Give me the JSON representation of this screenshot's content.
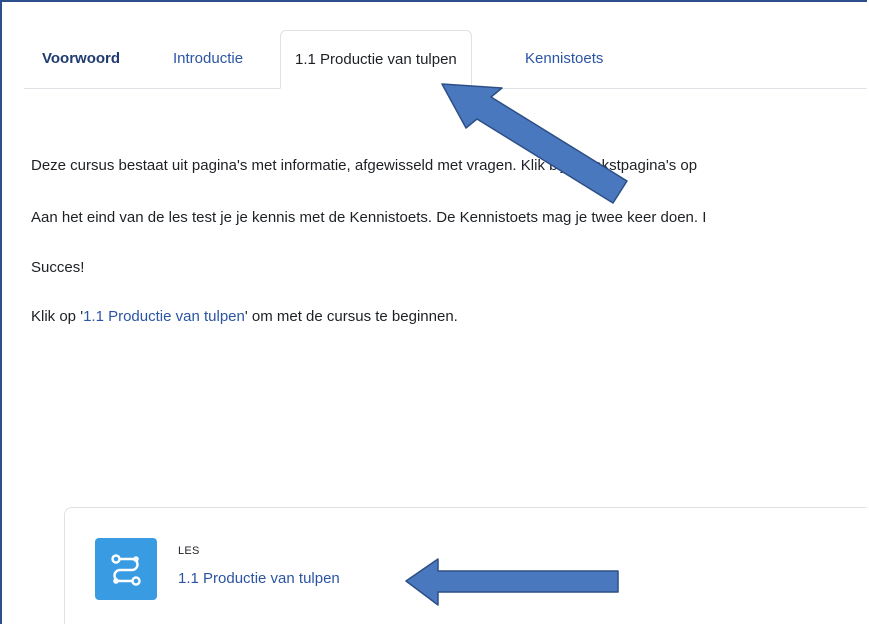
{
  "tabs": [
    {
      "label": "Voorwoord"
    },
    {
      "label": "Introductie"
    },
    {
      "label": "1.1 Productie van tulpen"
    },
    {
      "label": "Kennistoets"
    }
  ],
  "content": {
    "paragraph1": "Deze cursus bestaat uit pagina's met informatie, afgewisseld met vragen. Klik bij de tekstpagina's op",
    "paragraph2": "Aan het eind van de les test je je kennis met de Kennistoets. De Kennistoets mag je twee keer doen. I",
    "paragraph3": "Succes!",
    "paragraph4_prefix": "Klik op '",
    "paragraph4_link": "1.1 Productie van tulpen",
    "paragraph4_suffix": "' om met de cursus te beginnen."
  },
  "activity_card": {
    "type_label": "LES",
    "title": "1.1 Productie van tulpen",
    "icon": "lesson-path-icon",
    "icon_color": "#399be2"
  },
  "annotations": {
    "arrow_color": "#4a78be",
    "arrow_outline": "#2d4f86"
  }
}
